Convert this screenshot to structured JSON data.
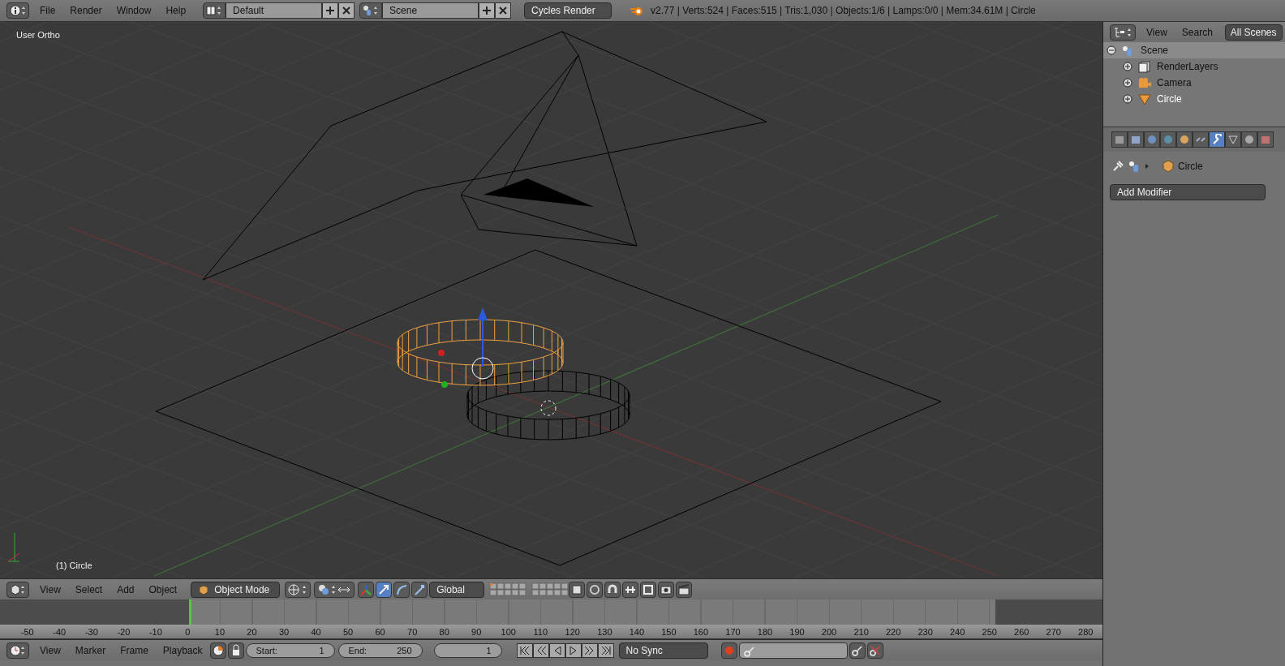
{
  "top_bar": {
    "menus": [
      "File",
      "Render",
      "Window",
      "Help"
    ],
    "layout": "Default",
    "scene": "Scene",
    "engine": "Cycles Render",
    "stats": "v2.77 | Verts:524 | Faces:515 | Tris:1,030 | Objects:1/6 | Lamps:0/0 | Mem:34.61M | Circle"
  },
  "viewport": {
    "view_label": "User Ortho",
    "object_label": "(1) Circle"
  },
  "viewport_header": {
    "menus": [
      "View",
      "Select",
      "Add",
      "Object"
    ],
    "mode": "Object Mode",
    "orientation": "Global"
  },
  "timeline": {
    "ticks": [
      "-50",
      "-40",
      "-30",
      "-20",
      "-10",
      "0",
      "10",
      "20",
      "30",
      "40",
      "50",
      "60",
      "70",
      "80",
      "90",
      "100",
      "110",
      "120",
      "130",
      "140",
      "150",
      "160",
      "170",
      "180",
      "190",
      "200",
      "210",
      "220",
      "230",
      "240",
      "250",
      "260",
      "270",
      "280"
    ]
  },
  "timeline_header": {
    "menus": [
      "View",
      "Marker",
      "Frame",
      "Playback"
    ],
    "start_label": "Start:",
    "start": "1",
    "end_label": "End:",
    "end": "250",
    "frame": "1",
    "sync": "No Sync"
  },
  "outliner": {
    "menus": [
      "View",
      "Search"
    ],
    "display": "All Scenes",
    "tree": [
      {
        "label": "Scene",
        "kind": "scene",
        "expanded": true,
        "selected": true,
        "active": false,
        "children": [
          {
            "label": "RenderLayers",
            "kind": "layers",
            "expanded": false,
            "selected": false,
            "active": false
          },
          {
            "label": "Camera",
            "kind": "camera",
            "expanded": false,
            "selected": false,
            "active": false
          },
          {
            "label": "Circle",
            "kind": "mesh",
            "expanded": false,
            "selected": false,
            "active": true
          }
        ]
      }
    ]
  },
  "properties": {
    "tabs": [
      {
        "kind": "render",
        "selected": false
      },
      {
        "kind": "layers",
        "selected": false
      },
      {
        "kind": "scene",
        "selected": false
      },
      {
        "kind": "world",
        "selected": false
      },
      {
        "kind": "object",
        "selected": false
      },
      {
        "kind": "constraints",
        "selected": false
      },
      {
        "kind": "modifiers",
        "selected": true
      },
      {
        "kind": "data",
        "selected": false
      },
      {
        "kind": "material",
        "selected": false
      },
      {
        "kind": "texture",
        "selected": false
      }
    ],
    "context": "Circle",
    "add_modifier": "Add Modifier"
  }
}
